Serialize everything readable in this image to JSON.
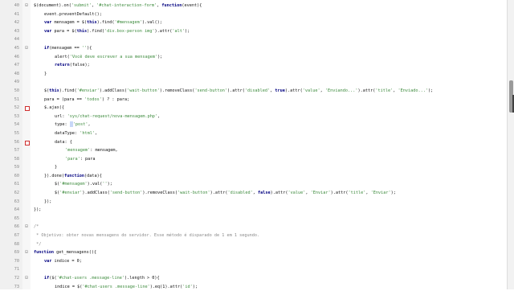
{
  "editor": {
    "lines": [
      {
        "n": "40",
        "marker": "fold",
        "indent": 0,
        "parts": [
          [
            "fn",
            "$(document).on("
          ],
          [
            "str",
            "'submit'"
          ],
          [
            "fn",
            ", "
          ],
          [
            "str",
            "'#chat-interaction-form'"
          ],
          [
            "fn",
            ", "
          ],
          [
            "kw",
            "function"
          ],
          [
            "fn",
            "(event){"
          ]
        ]
      },
      {
        "n": "41",
        "marker": "",
        "indent": 2,
        "parts": [
          [
            "fn",
            "event.preventDefault();"
          ]
        ]
      },
      {
        "n": "42",
        "marker": "",
        "indent": 2,
        "parts": [
          [
            "kw",
            "var"
          ],
          [
            "fn",
            " mensagem = $("
          ],
          [
            "kw",
            "this"
          ],
          [
            "fn",
            ").find("
          ],
          [
            "str",
            "'#mensagem'"
          ],
          [
            "fn",
            ").val();"
          ]
        ]
      },
      {
        "n": "43",
        "marker": "",
        "indent": 2,
        "parts": [
          [
            "kw",
            "var"
          ],
          [
            "fn",
            " para = $("
          ],
          [
            "kw",
            "this"
          ],
          [
            "fn",
            ").find("
          ],
          [
            "str",
            "'div.box-person img'"
          ],
          [
            "fn",
            ").attr("
          ],
          [
            "str",
            "'alt'"
          ],
          [
            "fn",
            ");"
          ]
        ]
      },
      {
        "n": "44",
        "marker": "",
        "indent": 0,
        "parts": []
      },
      {
        "n": "45",
        "marker": "fold",
        "indent": 2,
        "parts": [
          [
            "kw",
            "if"
          ],
          [
            "fn",
            "(mensagem == "
          ],
          [
            "str",
            "''"
          ],
          [
            "fn",
            "){"
          ]
        ]
      },
      {
        "n": "46",
        "marker": "",
        "indent": 4,
        "parts": [
          [
            "fn",
            "alert("
          ],
          [
            "str",
            "'Você deve escrever a sua mensagem'"
          ],
          [
            "fn",
            ");"
          ]
        ]
      },
      {
        "n": "47",
        "marker": "",
        "indent": 4,
        "parts": [
          [
            "kw",
            "return"
          ],
          [
            "fn",
            "(false);"
          ]
        ]
      },
      {
        "n": "48",
        "marker": "",
        "indent": 2,
        "parts": [
          [
            "fn",
            "}"
          ]
        ]
      },
      {
        "n": "49",
        "marker": "",
        "indent": 0,
        "parts": []
      },
      {
        "n": "50",
        "marker": "",
        "indent": 2,
        "parts": [
          [
            "fn",
            "$("
          ],
          [
            "kw",
            "this"
          ],
          [
            "fn",
            ").find("
          ],
          [
            "str",
            "'#enviar'"
          ],
          [
            "fn",
            ").addClass("
          ],
          [
            "str",
            "'wait-button'"
          ],
          [
            "fn",
            ").removeClass("
          ],
          [
            "str",
            "'send-button'"
          ],
          [
            "fn",
            ").attr("
          ],
          [
            "str",
            "'disabled'"
          ],
          [
            "fn",
            ", "
          ],
          [
            "kw",
            "true"
          ],
          [
            "fn",
            ").attr("
          ],
          [
            "str",
            "'value'"
          ],
          [
            "fn",
            ", "
          ],
          [
            "str",
            "'Enviando...'"
          ],
          [
            "fn",
            ").attr("
          ],
          [
            "str",
            "'title'"
          ],
          [
            "fn",
            ", "
          ],
          [
            "str",
            "'Enviado...'"
          ],
          [
            "fn",
            ");"
          ]
        ]
      },
      {
        "n": "51",
        "marker": "",
        "indent": 2,
        "parts": [
          [
            "fn",
            "para = (para == "
          ],
          [
            "str",
            "'todos'"
          ],
          [
            "fn",
            ") ? : para;"
          ]
        ]
      },
      {
        "n": "52",
        "marker": "bp",
        "indent": 2,
        "parts": [
          [
            "fn",
            "$.ajax({"
          ]
        ]
      },
      {
        "n": "53",
        "marker": "",
        "indent": 4,
        "parts": [
          [
            "fn",
            "url: "
          ],
          [
            "str",
            "'sys/chat-request/nova-mensagem.php'"
          ],
          [
            "fn",
            ","
          ]
        ]
      },
      {
        "n": "54",
        "marker": "",
        "indent": 4,
        "parts": [
          [
            "fn",
            "type: "
          ],
          [
            "cursor",
            ""
          ],
          [
            "str",
            "'post'"
          ],
          [
            "fn",
            ","
          ]
        ]
      },
      {
        "n": "55",
        "marker": "",
        "indent": 4,
        "parts": [
          [
            "fn",
            "dataType: "
          ],
          [
            "str",
            "'html'"
          ],
          [
            "fn",
            ","
          ]
        ]
      },
      {
        "n": "56",
        "marker": "bp",
        "indent": 4,
        "parts": [
          [
            "fn",
            "data: {"
          ]
        ]
      },
      {
        "n": "57",
        "marker": "",
        "indent": 6,
        "parts": [
          [
            "str",
            "'mensagem'"
          ],
          [
            "fn",
            ": mensagem,"
          ]
        ]
      },
      {
        "n": "58",
        "marker": "",
        "indent": 6,
        "parts": [
          [
            "str",
            "'para'"
          ],
          [
            "fn",
            ": para"
          ]
        ]
      },
      {
        "n": "59",
        "marker": "",
        "indent": 4,
        "parts": [
          [
            "fn",
            "}"
          ]
        ]
      },
      {
        "n": "60",
        "marker": "",
        "indent": 2,
        "parts": [
          [
            "fn",
            "}).done("
          ],
          [
            "kw",
            "function"
          ],
          [
            "fn",
            "(data){"
          ]
        ]
      },
      {
        "n": "61",
        "marker": "",
        "indent": 4,
        "parts": [
          [
            "fn",
            "$("
          ],
          [
            "str",
            "'#mensagem'"
          ],
          [
            "fn",
            ").val("
          ],
          [
            "str",
            "''"
          ],
          [
            "fn",
            ");"
          ]
        ]
      },
      {
        "n": "62",
        "marker": "",
        "indent": 4,
        "parts": [
          [
            "fn",
            "$("
          ],
          [
            "str",
            "'#enviar'"
          ],
          [
            "fn",
            ").addClass("
          ],
          [
            "str",
            "'send-button'"
          ],
          [
            "fn",
            ").removeClass("
          ],
          [
            "str",
            "'wait-button'"
          ],
          [
            "fn",
            ").attr("
          ],
          [
            "str",
            "'disabled'"
          ],
          [
            "fn",
            ", "
          ],
          [
            "kw",
            "false"
          ],
          [
            "fn",
            ").attr("
          ],
          [
            "str",
            "'value'"
          ],
          [
            "fn",
            ", "
          ],
          [
            "str",
            "'Enviar'"
          ],
          [
            "fn",
            ").attr("
          ],
          [
            "str",
            "'title'"
          ],
          [
            "fn",
            ", "
          ],
          [
            "str",
            "'Enviar'"
          ],
          [
            "fn",
            ");"
          ]
        ]
      },
      {
        "n": "63",
        "marker": "",
        "indent": 2,
        "parts": [
          [
            "fn",
            "});"
          ]
        ]
      },
      {
        "n": "64",
        "marker": "",
        "indent": 0,
        "parts": [
          [
            "fn",
            "});"
          ]
        ]
      },
      {
        "n": "65",
        "marker": "",
        "indent": 0,
        "parts": []
      },
      {
        "n": "66",
        "marker": "fold",
        "indent": 0,
        "parts": [
          [
            "cm",
            "/*"
          ]
        ]
      },
      {
        "n": "67",
        "marker": "",
        "indent": 0,
        "parts": [
          [
            "cm",
            " * Objetivo: obter novas mensagens do servidor. Esse método é disparado de 1 em 1 segundo."
          ]
        ]
      },
      {
        "n": "68",
        "marker": "",
        "indent": 0,
        "parts": [
          [
            "cm",
            " */"
          ]
        ]
      },
      {
        "n": "69",
        "marker": "fold",
        "indent": 0,
        "parts": [
          [
            "kw",
            "function"
          ],
          [
            "fn",
            " get_mensagens(){"
          ]
        ]
      },
      {
        "n": "70",
        "marker": "",
        "indent": 2,
        "parts": [
          [
            "kw",
            "var"
          ],
          [
            "fn",
            " indice = 0;"
          ]
        ]
      },
      {
        "n": "71",
        "marker": "",
        "indent": 0,
        "parts": []
      },
      {
        "n": "72",
        "marker": "fold",
        "indent": 2,
        "parts": [
          [
            "kw",
            "if"
          ],
          [
            "fn",
            "($("
          ],
          [
            "str",
            "'#chat-users .message-line'"
          ],
          [
            "fn",
            ").length > 0){"
          ]
        ]
      },
      {
        "n": "73",
        "marker": "",
        "indent": 4,
        "parts": [
          [
            "fn",
            "indice = $("
          ],
          [
            "str",
            "'#chat-users .message-line'"
          ],
          [
            "fn",
            ").eq(1).attr("
          ],
          [
            "str",
            "'id'"
          ],
          [
            "fn",
            ");"
          ]
        ]
      }
    ]
  }
}
